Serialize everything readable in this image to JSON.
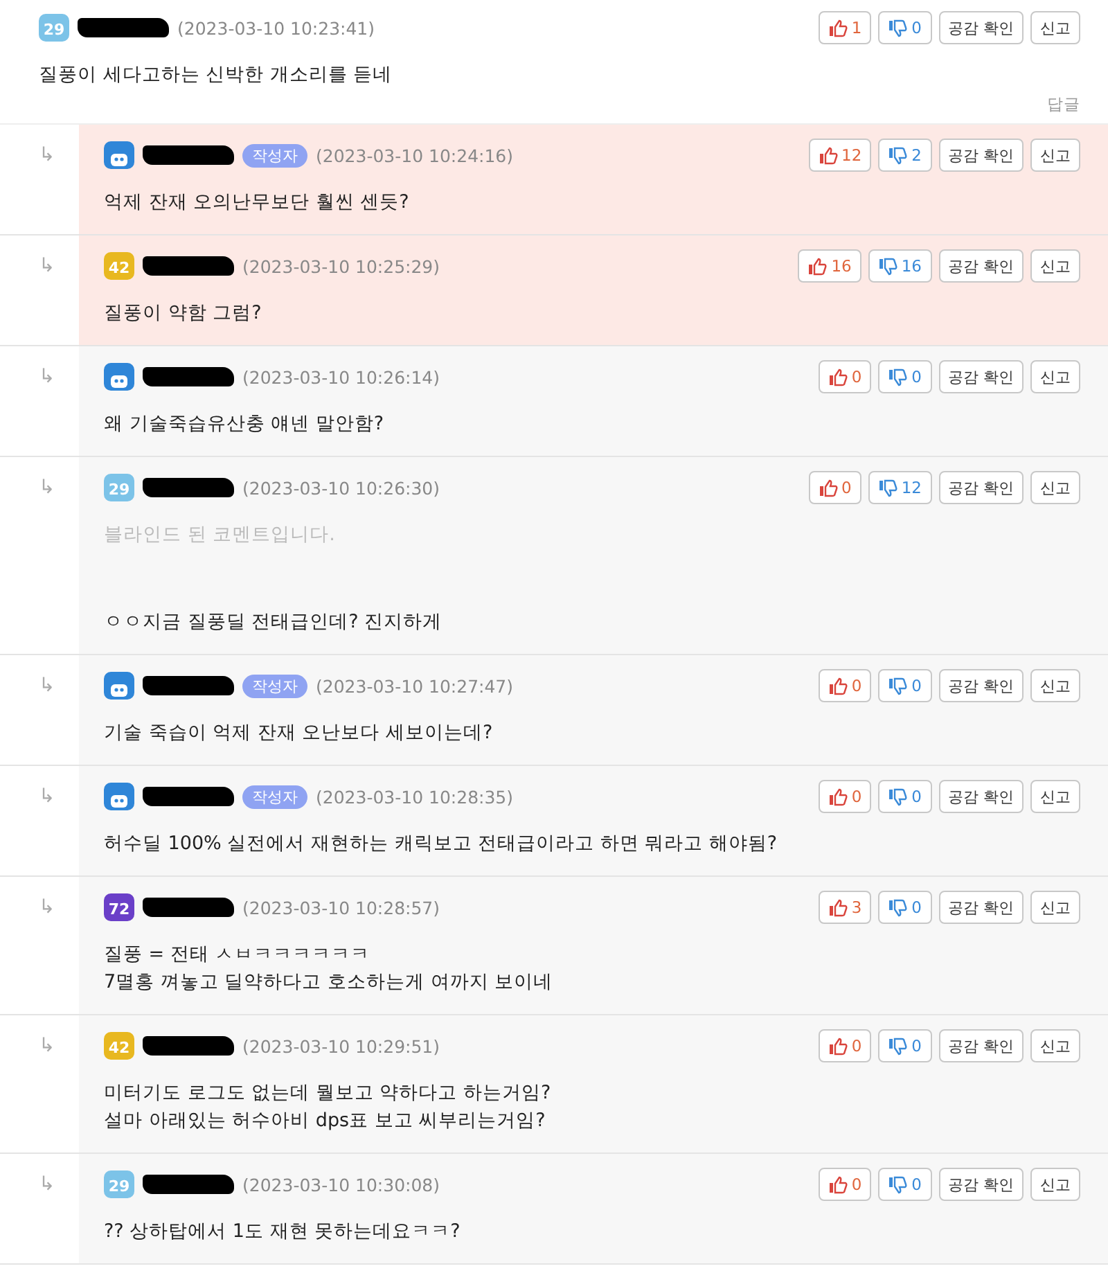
{
  "comment": {
    "badge": {
      "label": "29",
      "color": "#7cc3e8"
    },
    "date": "(2023-03-10 10:23:41)",
    "likes": "1",
    "dislikes": "0",
    "empathy": "공감 확인",
    "report": "신고",
    "body": [
      "질풍이 세다고하는 신박한 개소리를 듣네"
    ],
    "reply_link": "답글"
  },
  "replies": [
    {
      "arrow": "↳",
      "badge": {
        "color": "#2f86d8"
      },
      "author_tag": "작성자",
      "highlighted": true,
      "date": "(2023-03-10 10:24:16)",
      "likes": "12",
      "dislikes": "2",
      "empathy": "공감 확인",
      "report": "신고",
      "body": [
        "억제 잔재 오의난무보단 훨씬 센듯?"
      ]
    },
    {
      "arrow": "↳",
      "badge": {
        "label": "42",
        "color": "#e8b820"
      },
      "highlighted": true,
      "date": "(2023-03-10 10:25:29)",
      "likes": "16",
      "dislikes": "16",
      "empathy": "공감 확인",
      "report": "신고",
      "body": [
        "질풍이 약함 그럼?"
      ]
    },
    {
      "arrow": "↳",
      "badge": {
        "color": "#2f86d8"
      },
      "highlighted": false,
      "date": "(2023-03-10 10:26:14)",
      "likes": "0",
      "dislikes": "0",
      "empathy": "공감 확인",
      "report": "신고",
      "body": [
        "왜 기술죽습유산충 얘넨 말안함?"
      ]
    },
    {
      "arrow": "↳",
      "badge": {
        "label": "29",
        "color": "#7cc3e8"
      },
      "highlighted": false,
      "date": "(2023-03-10 10:26:30)",
      "likes": "0",
      "dislikes": "12",
      "empathy": "공감 확인",
      "report": "신고",
      "blind_notice": "블라인드 된 코멘트입니다.",
      "body": [
        "ㅇㅇ지금 질풍딜 전태급인데? 진지하게"
      ]
    },
    {
      "arrow": "↳",
      "badge": {
        "color": "#2f86d8"
      },
      "author_tag": "작성자",
      "highlighted": false,
      "date": "(2023-03-10 10:27:47)",
      "likes": "0",
      "dislikes": "0",
      "empathy": "공감 확인",
      "report": "신고",
      "body": [
        "기술 죽습이 억제 잔재 오난보다 세보이는데?"
      ]
    },
    {
      "arrow": "↳",
      "badge": {
        "color": "#2f86d8"
      },
      "author_tag": "작성자",
      "highlighted": false,
      "date": "(2023-03-10 10:28:35)",
      "likes": "0",
      "dislikes": "0",
      "empathy": "공감 확인",
      "report": "신고",
      "body": [
        "허수딜 100% 실전에서 재현하는 캐릭보고 전태급이라고 하면 뭐라고 해야됨?"
      ]
    },
    {
      "arrow": "↳",
      "badge": {
        "label": "72",
        "color": "#6a3fc8"
      },
      "highlighted": false,
      "date": "(2023-03-10 10:28:57)",
      "likes": "3",
      "dislikes": "0",
      "empathy": "공감 확인",
      "report": "신고",
      "body": [
        "질풍 = 전태 ㅅㅂㅋㅋㅋㅋㅋㅋ",
        "7멸홍 껴놓고 딜약하다고 호소하는게 여까지 보이네"
      ]
    },
    {
      "arrow": "↳",
      "badge": {
        "label": "42",
        "color": "#e8b820"
      },
      "highlighted": false,
      "date": "(2023-03-10 10:29:51)",
      "likes": "0",
      "dislikes": "0",
      "empathy": "공감 확인",
      "report": "신고",
      "body": [
        "미터기도 로그도 없는데 뭘보고 약하다고 하는거임?",
        "설마 아래있는 허수아비 dps표 보고 씨부리는거임?"
      ]
    },
    {
      "arrow": "↳",
      "badge": {
        "label": "29",
        "color": "#7cc3e8"
      },
      "highlighted": false,
      "date": "(2023-03-10 10:30:08)",
      "likes": "0",
      "dislikes": "0",
      "empathy": "공감 확인",
      "report": "신고",
      "body": [
        "?? 상하탑에서 1도 재현 못하는데요ㅋㅋ?"
      ]
    }
  ]
}
